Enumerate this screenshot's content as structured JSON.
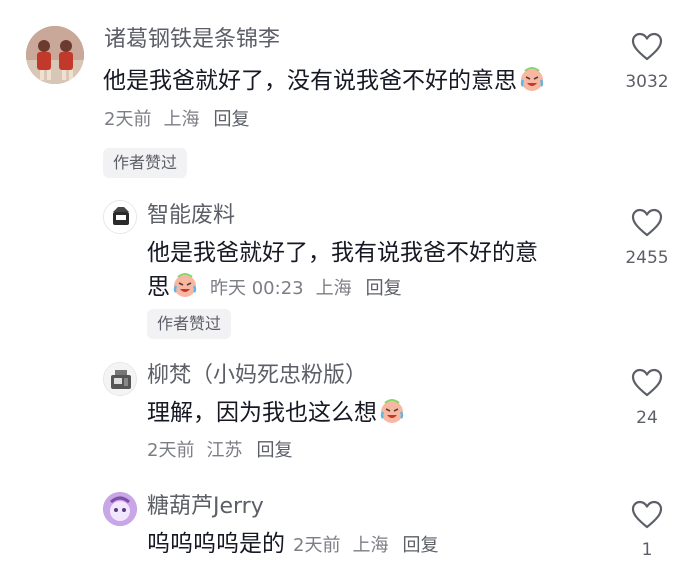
{
  "comments": [
    {
      "username": "诸葛钢铁是条锦李",
      "text": "他是我爸就好了，没有说我爸不好的意思",
      "date": "2天前",
      "location": "上海",
      "reply_label": "回复",
      "badge": "作者赞过",
      "likes": "3032",
      "avatar_colors": [
        "#b06a5a",
        "#d9c9b8"
      ]
    },
    {
      "username": "智能废料",
      "text_line1": "他是我爸就好了，我有说我爸不好的意",
      "text_line2": "思",
      "date": "昨天 00:23",
      "location": "上海",
      "reply_label": "回复",
      "badge": "作者赞过",
      "likes": "2455"
    },
    {
      "username": "柳梵（小妈死忠粉版）",
      "text": "理解，因为我也这么想",
      "date": "2天前",
      "location": "江苏",
      "reply_label": "回复",
      "likes": "24"
    },
    {
      "username": "糖葫芦Jerry",
      "text": "呜呜呜呜是的",
      "date": "2天前",
      "location": "上海",
      "reply_label": "回复",
      "likes": "1"
    }
  ],
  "icons": {
    "like": "heart-outline-icon",
    "emoji": "crying-laughing-emoji-icon"
  },
  "colors": {
    "text_primary": "#161823",
    "text_secondary": "#5c5f67",
    "text_meta": "#7c7e85",
    "badge_bg": "#f2f2f4",
    "emoji_face": "#f7b7a3",
    "emoji_tear": "#5ab7e8"
  }
}
